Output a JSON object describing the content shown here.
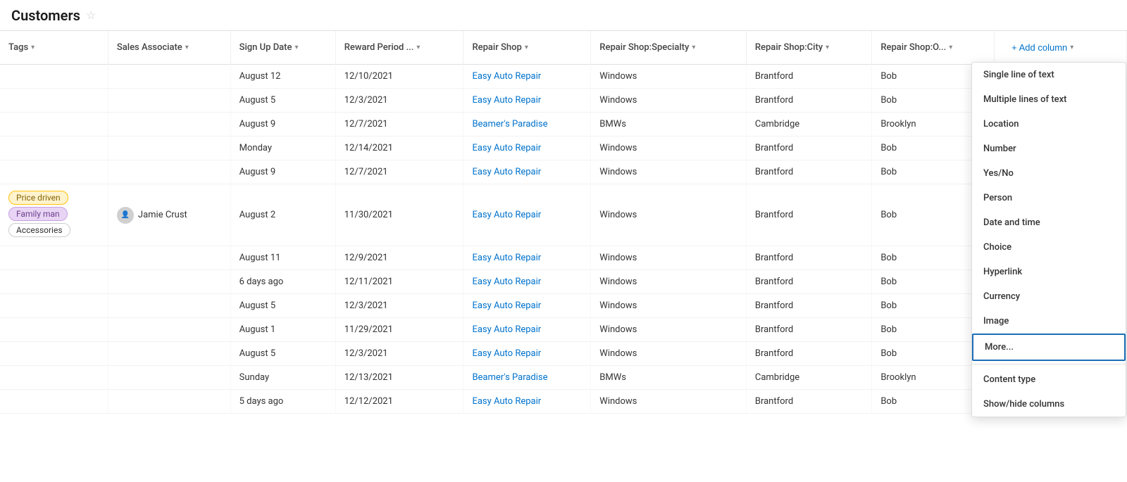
{
  "header": {
    "title": "Customers",
    "star_label": "★"
  },
  "columns": [
    {
      "id": "tags",
      "label": "Tags",
      "sortable": true
    },
    {
      "id": "sales_associate",
      "label": "Sales Associate",
      "sortable": true
    },
    {
      "id": "sign_up_date",
      "label": "Sign Up Date",
      "sortable": true
    },
    {
      "id": "reward_period",
      "label": "Reward Period ...",
      "sortable": true
    },
    {
      "id": "repair_shop",
      "label": "Repair Shop",
      "sortable": true
    },
    {
      "id": "repair_shop_specialty",
      "label": "Repair Shop:Specialty",
      "sortable": true
    },
    {
      "id": "repair_shop_city",
      "label": "Repair Shop:City",
      "sortable": true
    },
    {
      "id": "repair_shop_o",
      "label": "Repair Shop:O...",
      "sortable": true
    },
    {
      "id": "add_column",
      "label": "+ Add column",
      "sortable": true
    }
  ],
  "rows": [
    {
      "tags": "",
      "sales_associate": "",
      "sign_up_date": "August 12",
      "reward_period": "12/10/2021",
      "repair_shop": "Easy Auto Repair",
      "repair_shop_specialty": "Windows",
      "repair_shop_city": "Brantford",
      "repair_shop_o": "Bob"
    },
    {
      "tags": "",
      "sales_associate": "",
      "sign_up_date": "August 5",
      "reward_period": "12/3/2021",
      "repair_shop": "Easy Auto Repair",
      "repair_shop_specialty": "Windows",
      "repair_shop_city": "Brantford",
      "repair_shop_o": "Bob"
    },
    {
      "tags": "",
      "sales_associate": "",
      "sign_up_date": "August 9",
      "reward_period": "12/7/2021",
      "repair_shop": "Beamer's Paradise",
      "repair_shop_specialty": "BMWs",
      "repair_shop_city": "Cambridge",
      "repair_shop_o": "Brooklyn"
    },
    {
      "tags": "",
      "sales_associate": "",
      "sign_up_date": "Monday",
      "reward_period": "12/14/2021",
      "repair_shop": "Easy Auto Repair",
      "repair_shop_specialty": "Windows",
      "repair_shop_city": "Brantford",
      "repair_shop_o": "Bob"
    },
    {
      "tags": "",
      "sales_associate": "",
      "sign_up_date": "August 9",
      "reward_period": "12/7/2021",
      "repair_shop": "Easy Auto Repair",
      "repair_shop_specialty": "Windows",
      "repair_shop_city": "Brantford",
      "repair_shop_o": "Bob"
    },
    {
      "tags": "price_driven,family_man,accessories",
      "sales_associate": "Jamie Crust",
      "sign_up_date": "August 2",
      "reward_period": "11/30/2021",
      "repair_shop": "Easy Auto Repair",
      "repair_shop_specialty": "Windows",
      "repair_shop_city": "Brantford",
      "repair_shop_o": "Bob"
    },
    {
      "tags": "",
      "sales_associate": "",
      "sign_up_date": "August 11",
      "reward_period": "12/9/2021",
      "repair_shop": "Easy Auto Repair",
      "repair_shop_specialty": "Windows",
      "repair_shop_city": "Brantford",
      "repair_shop_o": "Bob"
    },
    {
      "tags": "",
      "sales_associate": "",
      "sign_up_date": "6 days ago",
      "reward_period": "12/11/2021",
      "repair_shop": "Easy Auto Repair",
      "repair_shop_specialty": "Windows",
      "repair_shop_city": "Brantford",
      "repair_shop_o": "Bob"
    },
    {
      "tags": "",
      "sales_associate": "",
      "sign_up_date": "August 5",
      "reward_period": "12/3/2021",
      "repair_shop": "Easy Auto Repair",
      "repair_shop_specialty": "Windows",
      "repair_shop_city": "Brantford",
      "repair_shop_o": "Bob"
    },
    {
      "tags": "",
      "sales_associate": "",
      "sign_up_date": "August 1",
      "reward_period": "11/29/2021",
      "repair_shop": "Easy Auto Repair",
      "repair_shop_specialty": "Windows",
      "repair_shop_city": "Brantford",
      "repair_shop_o": "Bob"
    },
    {
      "tags": "",
      "sales_associate": "",
      "sign_up_date": "August 5",
      "reward_period": "12/3/2021",
      "repair_shop": "Easy Auto Repair",
      "repair_shop_specialty": "Windows",
      "repair_shop_city": "Brantford",
      "repair_shop_o": "Bob"
    },
    {
      "tags": "",
      "sales_associate": "",
      "sign_up_date": "Sunday",
      "reward_period": "12/13/2021",
      "repair_shop": "Beamer's Paradise",
      "repair_shop_specialty": "BMWs",
      "repair_shop_city": "Cambridge",
      "repair_shop_o": "Brooklyn"
    },
    {
      "tags": "",
      "sales_associate": "",
      "sign_up_date": "5 days ago",
      "reward_period": "12/12/2021",
      "repair_shop": "Easy Auto Repair",
      "repair_shop_specialty": "Windows",
      "repair_shop_city": "Brantford",
      "repair_shop_o": "Bob"
    }
  ],
  "dropdown": {
    "items": [
      {
        "id": "single_line",
        "label": "Single line of text"
      },
      {
        "id": "multiple_lines",
        "label": "Multiple lines of text"
      },
      {
        "id": "location",
        "label": "Location"
      },
      {
        "id": "number",
        "label": "Number"
      },
      {
        "id": "yes_no",
        "label": "Yes/No"
      },
      {
        "id": "person",
        "label": "Person"
      },
      {
        "id": "date_time",
        "label": "Date and time"
      },
      {
        "id": "choice",
        "label": "Choice"
      },
      {
        "id": "hyperlink",
        "label": "Hyperlink"
      },
      {
        "id": "currency",
        "label": "Currency"
      },
      {
        "id": "image",
        "label": "Image"
      },
      {
        "id": "more",
        "label": "More...",
        "highlighted": true
      },
      {
        "id": "content_type",
        "label": "Content type"
      },
      {
        "id": "show_hide",
        "label": "Show/hide columns"
      }
    ]
  },
  "tags": {
    "price_driven": "Price driven",
    "family_man": "Family man",
    "accessories": "Accessories"
  }
}
